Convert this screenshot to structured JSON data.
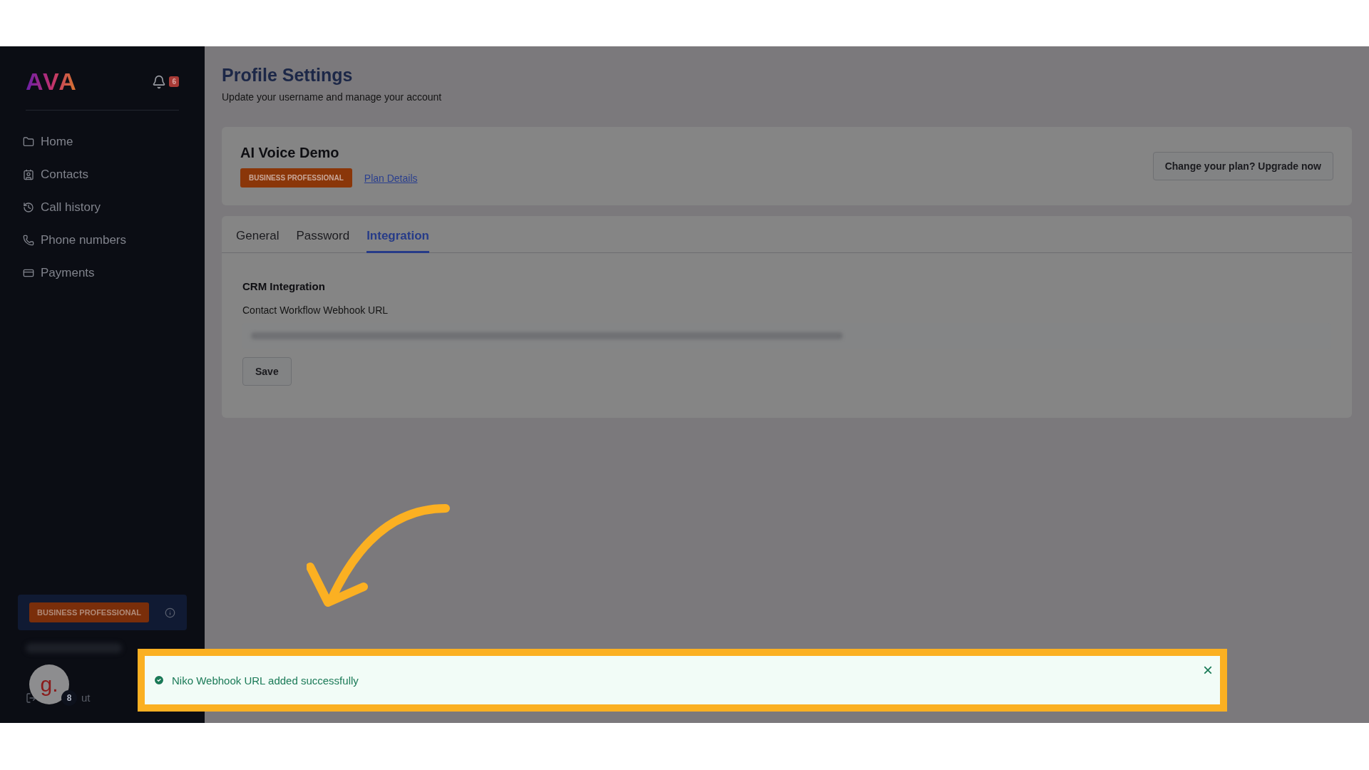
{
  "sidebar": {
    "logo": "AVA",
    "notifications": "6",
    "items": [
      {
        "label": "Home",
        "selected": false
      },
      {
        "label": "Contacts",
        "selected": false
      },
      {
        "label": "Call history",
        "selected": false
      },
      {
        "label": "Phone numbers",
        "selected": false
      },
      {
        "label": "Payments",
        "selected": false
      }
    ],
    "plan_badge": "BUSINESS PROFESSIONAL",
    "avatar_letter": "g.",
    "avatar_badge": "8",
    "logout_label": "ut"
  },
  "page": {
    "title": "Profile Settings",
    "subtitle": "Update your username and manage your account"
  },
  "account": {
    "name": "AI Voice Demo",
    "plan_badge": "BUSINESS PROFESSIONAL",
    "plan_link": "Plan Details",
    "upgrade_button": "Change your plan? Upgrade now"
  },
  "tabs": [
    {
      "label": "General",
      "selected": false
    },
    {
      "label": "Password",
      "selected": false
    },
    {
      "label": "Integration",
      "selected": true
    }
  ],
  "integration": {
    "heading": "CRM Integration",
    "field_label": "Contact Workflow Webhook URL",
    "save_button": "Save"
  },
  "toast": {
    "message": "Niko Webhook URL added successfully",
    "close": "×"
  }
}
